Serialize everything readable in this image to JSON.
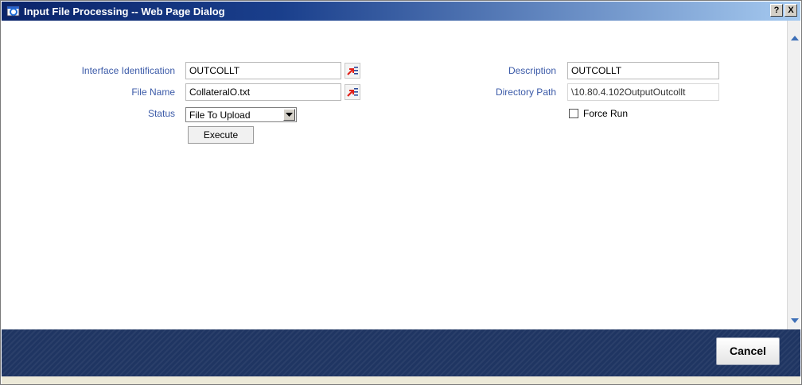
{
  "window": {
    "title": "Input File Processing -- Web Page Dialog",
    "help_button": "?",
    "close_button": "X"
  },
  "form": {
    "interface_identification": {
      "label": "Interface Identification",
      "value": "OUTCOLLT"
    },
    "file_name": {
      "label": "File Name",
      "value": "CollateralO.txt"
    },
    "status": {
      "label": "Status",
      "value": "File To Upload"
    },
    "execute_label": "Execute",
    "description": {
      "label": "Description",
      "value": "OUTCOLLT"
    },
    "directory_path": {
      "label": "Directory Path",
      "value": "\\10.80.4.102OutputOutcollt"
    },
    "force_run_label": "Force Run"
  },
  "footer": {
    "cancel_label": "Cancel"
  },
  "colors": {
    "label_text": "#3b5aa8",
    "footer_bg": "#1f3562",
    "lov_icon_red": "#e0201a",
    "lov_icon_blue": "#2b4a9a"
  },
  "icons": [
    "ie-dialog-icon",
    "help-icon",
    "close-icon",
    "lov-icon",
    "scroll-up-icon",
    "scroll-down-icon",
    "dropdown-arrow-icon"
  ]
}
